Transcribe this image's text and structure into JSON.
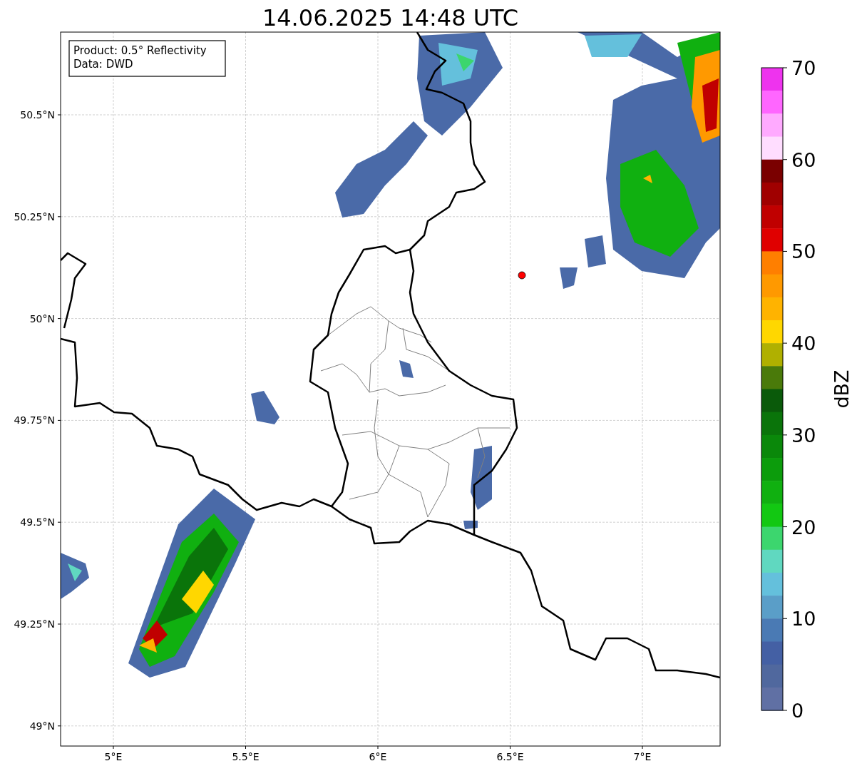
{
  "title": "14.06.2025 14:48 UTC",
  "legend": {
    "lines": [
      "Product: 0.5° Reflectivity",
      "Data: DWD"
    ]
  },
  "x_axis": {
    "labels": [
      "5°E",
      "5.5°E",
      "6°E",
      "6.5°E",
      "7°E"
    ]
  },
  "y_axis": {
    "labels": [
      "50.5°N",
      "50.25°N",
      "50°N",
      "49.75°N",
      "49.5°N",
      "49.25°N",
      "49°N"
    ]
  },
  "colorbar": {
    "label": "dBZ",
    "ticks": [
      "70",
      "60",
      "50",
      "40",
      "30",
      "20",
      "10",
      "0"
    ],
    "segments": [
      {
        "color": "#ee33ee"
      },
      {
        "color": "#ff66ff"
      },
      {
        "color": "#ffaaff"
      },
      {
        "color": "#ffddff"
      },
      {
        "color": "#7a0000"
      },
      {
        "color": "#a00000"
      },
      {
        "color": "#c00000"
      },
      {
        "color": "#e00000"
      },
      {
        "color": "#ff7f00"
      },
      {
        "color": "#ff9900"
      },
      {
        "color": "#ffb300"
      },
      {
        "color": "#ffd700"
      },
      {
        "color": "#b0b000"
      },
      {
        "color": "#4a7a0a"
      },
      {
        "color": "#0a5a0a"
      },
      {
        "color": "#0a740a"
      },
      {
        "color": "#0a880a"
      },
      {
        "color": "#0c9c0c"
      },
      {
        "color": "#10b010"
      },
      {
        "color": "#12c812"
      },
      {
        "color": "#3cd66e"
      },
      {
        "color": "#60d8c0"
      },
      {
        "color": "#64c0dc"
      },
      {
        "color": "#5a9ec8"
      },
      {
        "color": "#4a7ab4"
      },
      {
        "color": "#4460a4"
      },
      {
        "color": "#50689e"
      },
      {
        "color": "#6070a4"
      }
    ]
  }
}
